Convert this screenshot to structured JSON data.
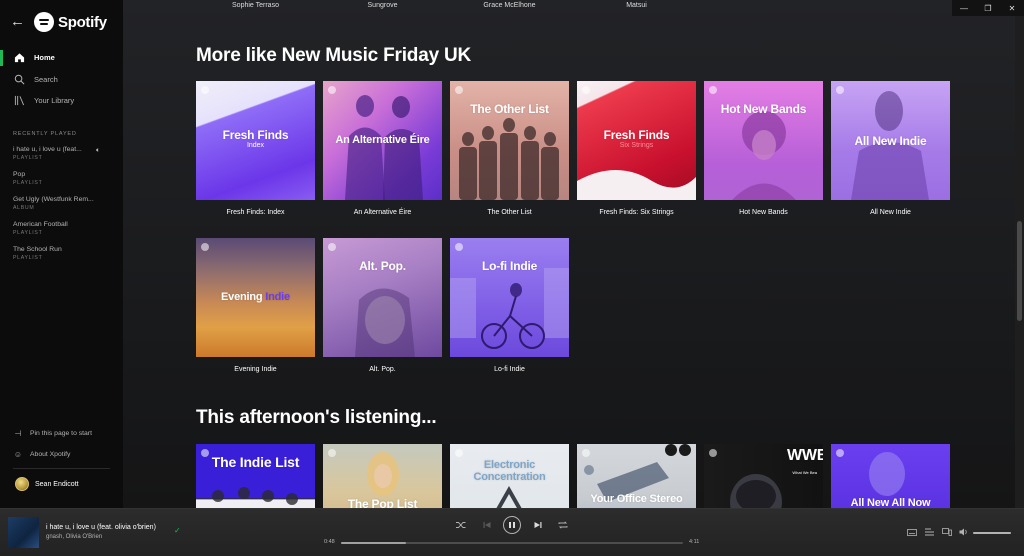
{
  "sidebar": {
    "brand": "Spotify",
    "nav": [
      {
        "label": "Home",
        "icon": "home-icon"
      },
      {
        "label": "Search",
        "icon": "search-icon"
      },
      {
        "label": "Your Library",
        "icon": "library-icon"
      }
    ],
    "recently_played_heading": "RECENTLY PLAYED",
    "recently_played": [
      {
        "title": "i hate u, i love u (feat...",
        "type": "PLAYLIST"
      },
      {
        "title": "Pop",
        "type": "PLAYLIST"
      },
      {
        "title": "Get Ugly (Westfunk Rem...",
        "type": "ALBUM"
      },
      {
        "title": "American Football",
        "type": "PLAYLIST"
      },
      {
        "title": "The School Run",
        "type": "PLAYLIST"
      }
    ],
    "pin_label": "Pin this page to start",
    "about_label": "About Xpotify",
    "user_name": "Sean Endicott"
  },
  "main": {
    "previous_row": [
      "Sophie Terraso",
      "Sungrove",
      "Grace McElhone",
      "Matsui"
    ],
    "section1": {
      "title": "More like New Music Friday UK",
      "cards": [
        {
          "title": "Fresh Finds: Index",
          "art_text": "Fresh Finds",
          "art_sub": "Index"
        },
        {
          "title": "An Alternative Éire",
          "art_text": "An Alternative Éire"
        },
        {
          "title": "The Other List",
          "art_text": "The Other List"
        },
        {
          "title": "Fresh Finds: Six Strings",
          "art_text": "Fresh Finds",
          "art_sub": "Six Strings"
        },
        {
          "title": "Hot New Bands",
          "art_text": "Hot New Bands"
        },
        {
          "title": "All New Indie",
          "art_text": "All New Indie"
        },
        {
          "title": "Evening Indie",
          "art_text": "Evening",
          "art_text_accent": "Indie"
        },
        {
          "title": "Alt. Pop.",
          "art_text": "Alt. Pop."
        },
        {
          "title": "Lo-fi Indie",
          "art_text": "Lo-fi Indie"
        }
      ]
    },
    "section2": {
      "title": "This afternoon's listening...",
      "cards": [
        {
          "art_text": "The Indie List"
        },
        {
          "art_text": "The Pop List"
        },
        {
          "art_text": "Electronic Concentration"
        },
        {
          "art_text": "Your Office Stereo"
        },
        {
          "art_text": "WWB",
          "art_sub": "What We Bea"
        },
        {
          "art_text": "All New All Now"
        }
      ]
    }
  },
  "player": {
    "track_title": "i hate u, i love u (feat. olivia o'brien)",
    "track_artist": "gnash, Olivia O'Brien",
    "elapsed": "0:48",
    "duration": "4:11",
    "progress": 0.19,
    "volume": 1.0,
    "accent": "#1db954"
  },
  "window": {
    "minimize": "—",
    "restore": "❐",
    "close": "✕"
  }
}
